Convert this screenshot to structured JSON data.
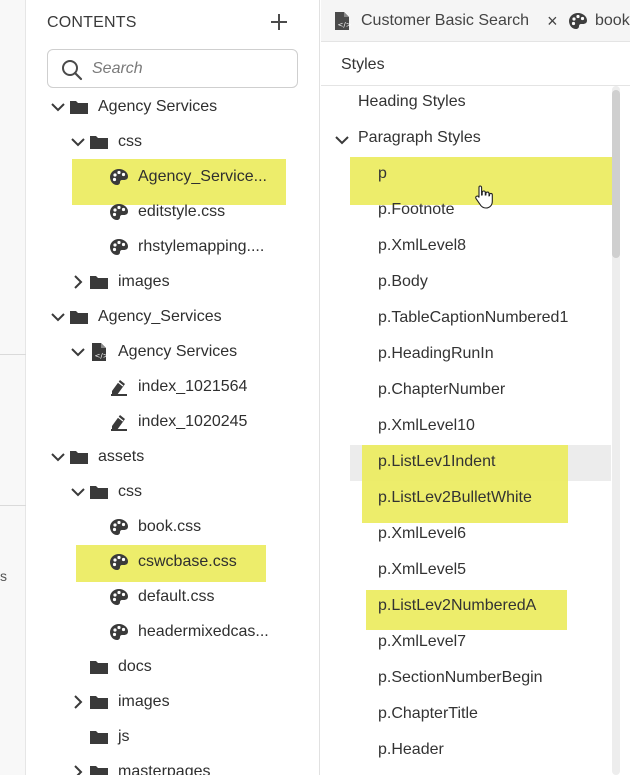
{
  "contents": {
    "title": "CONTENTS",
    "add_icon": "plus-icon",
    "search_placeholder": "Search",
    "tree": [
      {
        "label": "Agency Services",
        "icon": "folder-icon",
        "chevron": "down",
        "name": "tree-folder-agency-services"
      },
      {
        "label": "css",
        "icon": "folder-icon",
        "chevron": "down",
        "name": "tree-folder-css"
      },
      {
        "label": "Agency_Service...",
        "icon": "stylesheet-icon",
        "chevron": "none",
        "name": "tree-file-agency-service-css"
      },
      {
        "label": "editstyle.css",
        "icon": "stylesheet-icon",
        "chevron": "none",
        "name": "tree-file-editstyle-css"
      },
      {
        "label": "rhstylemapping....",
        "icon": "stylesheet-icon",
        "chevron": "none",
        "name": "tree-file-rhstylemapping"
      },
      {
        "label": "images",
        "icon": "folder-icon",
        "chevron": "right",
        "name": "tree-folder-images"
      },
      {
        "label": "Agency_Services",
        "icon": "folder-icon",
        "chevron": "down",
        "name": "tree-folder-agency-services-2"
      },
      {
        "label": "Agency Services",
        "icon": "html-file-icon",
        "chevron": "down",
        "name": "tree-file-agency-services-html"
      },
      {
        "label": "index_1021564",
        "icon": "index-file-icon",
        "chevron": "none",
        "name": "tree-file-index-1021564"
      },
      {
        "label": "index_1020245",
        "icon": "index-file-icon",
        "chevron": "none",
        "name": "tree-file-index-1020245"
      },
      {
        "label": "assets",
        "icon": "folder-icon",
        "chevron": "down",
        "name": "tree-folder-assets"
      },
      {
        "label": "css",
        "icon": "folder-icon",
        "chevron": "down",
        "name": "tree-folder-assets-css"
      },
      {
        "label": "book.css",
        "icon": "stylesheet-icon",
        "chevron": "none",
        "name": "tree-file-book-css"
      },
      {
        "label": "cswcbase.css",
        "icon": "stylesheet-icon",
        "chevron": "none",
        "name": "tree-file-cswcbase-css"
      },
      {
        "label": "default.css",
        "icon": "stylesheet-icon",
        "chevron": "none",
        "name": "tree-file-default-css"
      },
      {
        "label": "headermixedcas...",
        "icon": "stylesheet-icon",
        "chevron": "none",
        "name": "tree-file-headermixedcas"
      },
      {
        "label": "docs",
        "icon": "folder-icon",
        "chevron": "none",
        "name": "tree-folder-docs"
      },
      {
        "label": "images",
        "icon": "folder-icon",
        "chevron": "right",
        "name": "tree-folder-assets-images"
      },
      {
        "label": "js",
        "icon": "folder-icon",
        "chevron": "none",
        "name": "tree-folder-js"
      },
      {
        "label": "masterpages",
        "icon": "folder-icon",
        "chevron": "right",
        "name": "tree-folder-masterpages"
      }
    ]
  },
  "tabs": [
    {
      "label": "Customer Basic Search",
      "icon": "html-file-icon",
      "close": "×"
    },
    {
      "label": "book",
      "icon": "stylesheet-icon"
    }
  ],
  "styles": {
    "title": "Styles",
    "items": [
      {
        "label": "Heading Styles",
        "type": "group"
      },
      {
        "label": "Paragraph Styles",
        "type": "group-open"
      },
      {
        "label": "p",
        "type": "item"
      },
      {
        "label": "p.Footnote",
        "type": "item"
      },
      {
        "label": "p.XmlLevel8",
        "type": "item"
      },
      {
        "label": "p.Body",
        "type": "item"
      },
      {
        "label": "p.TableCaptionNumbered1",
        "type": "item"
      },
      {
        "label": "p.HeadingRunIn",
        "type": "item"
      },
      {
        "label": "p.ChapterNumber",
        "type": "item"
      },
      {
        "label": "p.XmlLevel10",
        "type": "item"
      },
      {
        "label": "p.ListLev1Indent",
        "type": "item"
      },
      {
        "label": "p.ListLev2BulletWhite",
        "type": "item"
      },
      {
        "label": "p.XmlLevel6",
        "type": "item"
      },
      {
        "label": "p.XmlLevel5",
        "type": "item"
      },
      {
        "label": "p.ListLev2NumberedA",
        "type": "item"
      },
      {
        "label": "p.XmlLevel7",
        "type": "item"
      },
      {
        "label": "p.SectionNumberBegin",
        "type": "item"
      },
      {
        "label": "p.ChapterTitle",
        "type": "item"
      },
      {
        "label": "p.Header",
        "type": "item"
      }
    ]
  },
  "left_strip": {
    "partial_text": "s"
  },
  "colors": {
    "highlight": "#ecec5e",
    "icon": "#3a3a3a",
    "text": "#2f2f2f"
  }
}
